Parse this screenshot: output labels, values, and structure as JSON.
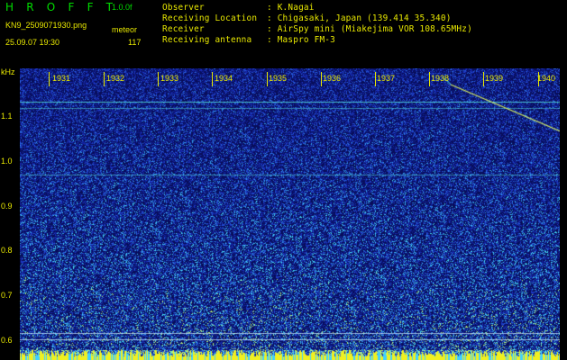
{
  "header": {
    "app_title": "H R O F F T",
    "version": "1.0.0f",
    "filename": "KN9_2509071930.png",
    "mode": "meteor",
    "datetime": "25.09.07 19:30",
    "count": "117"
  },
  "info": [
    {
      "label": "Observer",
      "value": ": K.Nagai"
    },
    {
      "label": "Receiving Location",
      "value": ": Chigasaki, Japan (139.414 35.340)"
    },
    {
      "label": "Receiver",
      "value": ": AirSpy mini (Miakejima VOR 108.65MHz)"
    },
    {
      "label": "Receiving antenna",
      "value": ": Maspro FM-3"
    }
  ],
  "axes": {
    "y_unit": "kHz",
    "y_ticks": [
      "1.1",
      "1.0",
      "0.9",
      "0.8",
      "0.7",
      "0.6"
    ],
    "x_ticks": [
      "1931",
      "1932",
      "1933",
      "1934",
      "1935",
      "1936",
      "1937",
      "1938",
      "1939",
      "1940"
    ]
  },
  "colors": {
    "text": "#e8e800",
    "title": "#00dd00",
    "background_noise": "#1a2fb0",
    "signal": "#39e6ff"
  }
}
